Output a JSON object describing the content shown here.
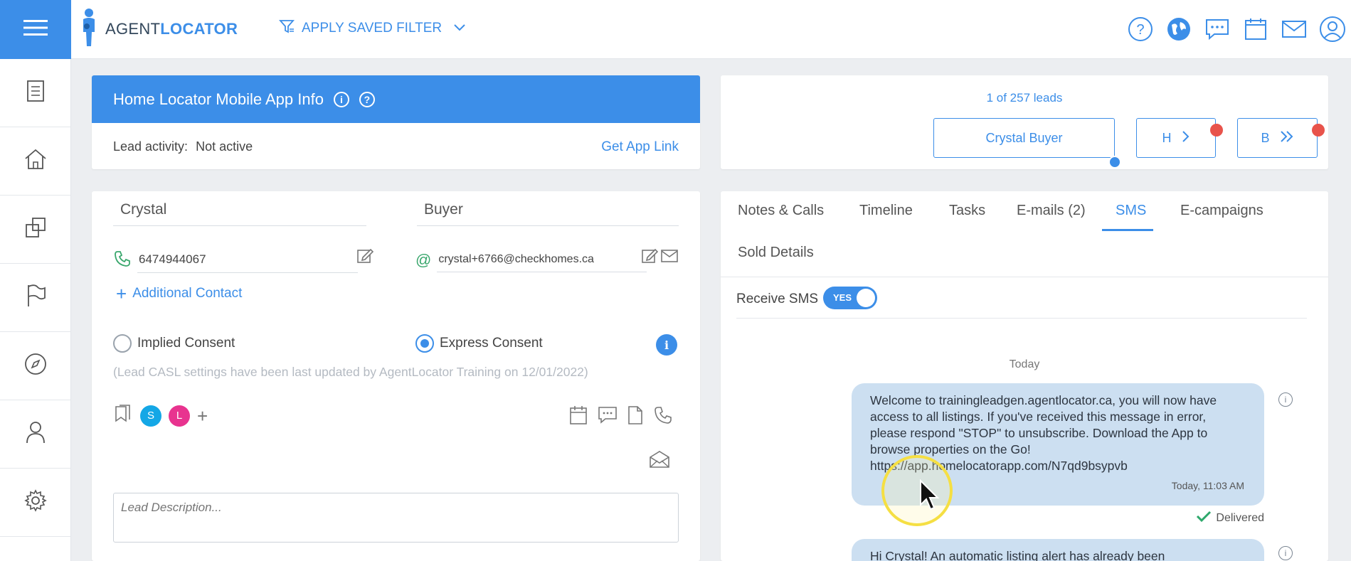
{
  "brand": {
    "logo_prefix": "AGENT",
    "logo_suffix": "LOCATOR"
  },
  "header": {
    "saved_filter_label": "APPLY SAVED FILTER",
    "icons": [
      "help-icon",
      "globe-icon",
      "chat-icon",
      "calendar-icon",
      "mail-icon",
      "user-icon"
    ]
  },
  "sidebar": {
    "items": [
      {
        "icon": "document-icon"
      },
      {
        "icon": "home-icon"
      },
      {
        "icon": "copy-icon"
      },
      {
        "icon": "flag-icon"
      },
      {
        "icon": "compass-icon"
      },
      {
        "icon": "person-icon"
      },
      {
        "icon": "settings-icon"
      }
    ]
  },
  "app_info": {
    "title": "Home Locator Mobile App Info",
    "activity_label": "Lead activity:",
    "activity_value": "Not active",
    "get_app_link": "Get App Link"
  },
  "lead_nav": {
    "count_text": "1 of 257 leads",
    "current_lead": "Crystal Buyer",
    "btn_h": "H",
    "btn_b": "B"
  },
  "lead": {
    "first_name": "Crystal",
    "last_name": "Buyer",
    "phone": "6474944067",
    "email": "crystal+6766@checkhomes.ca",
    "additional_contact": "Additional Contact",
    "implied_consent": "Implied Consent",
    "express_consent": "Express Consent",
    "casl_note": "(Lead CASL settings have been last updated by AgentLocator Training on 12/01/2022)",
    "tags": [
      "S",
      "L"
    ],
    "description_placeholder": "Lead Description..."
  },
  "tabs": {
    "items": [
      "Notes & Calls",
      "Timeline",
      "Tasks",
      "E-mails (2)",
      "SMS",
      "E-campaigns",
      "Sold Details"
    ],
    "active": "SMS"
  },
  "sms": {
    "receive_label": "Receive SMS",
    "toggle_label": "YES",
    "day_label": "Today",
    "message1": "Welcome to trainingleadgen.agentlocator.ca, you will now have access to all listings. If you've received this message in error, please respond \"STOP\" to unsubscribe. Download the App to browse properties on the Go! https://app.homelocatorapp.com/N7qd9bsypvb",
    "message1_time": "Today, 11:03 AM",
    "message1_status": "Delivered",
    "message2_partial": "Hi Crystal! An automatic listing alert has already been"
  },
  "colors": {
    "accent": "#3c8ee8",
    "alert_dot": "#e8534b",
    "tag_s": "#14a7e6",
    "tag_l": "#e8338f",
    "bubble": "#ccdff1"
  }
}
